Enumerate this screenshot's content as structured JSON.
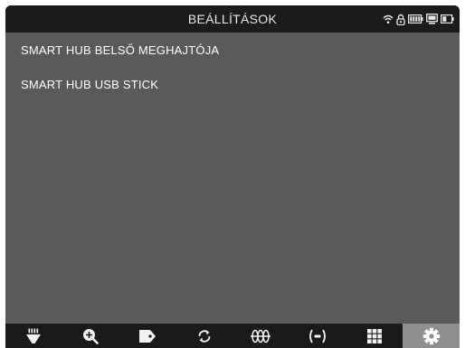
{
  "header": {
    "title": "BEÁLLÍTÁSOK",
    "status_icons": [
      "wifi-icon",
      "lock-icon",
      "battery-icon",
      "monitor-icon",
      "battery-small-icon"
    ]
  },
  "storage_list": {
    "items": [
      {
        "label": "SMART HUB BELSŐ MEGHAJTÓJA"
      },
      {
        "label": "SMART HUB USB STICK"
      }
    ]
  },
  "toolbar": {
    "buttons": [
      {
        "icon": "light-icon",
        "active": false
      },
      {
        "icon": "zoom-in-icon",
        "active": false
      },
      {
        "icon": "tag-icon",
        "active": false
      },
      {
        "icon": "refresh-icon",
        "active": false
      },
      {
        "icon": "wave-icon",
        "active": false
      },
      {
        "icon": "broadcast-icon",
        "active": false
      },
      {
        "icon": "grid-icon",
        "active": false
      },
      {
        "icon": "settings-icon",
        "active": true
      }
    ]
  },
  "colors": {
    "header_bg": "#1b1b1b",
    "content_bg": "#5a5a5a",
    "toolbar_bg": "#1a1a1a",
    "active_tool_bg": "#8f8f8f",
    "text": "#ffffff"
  }
}
